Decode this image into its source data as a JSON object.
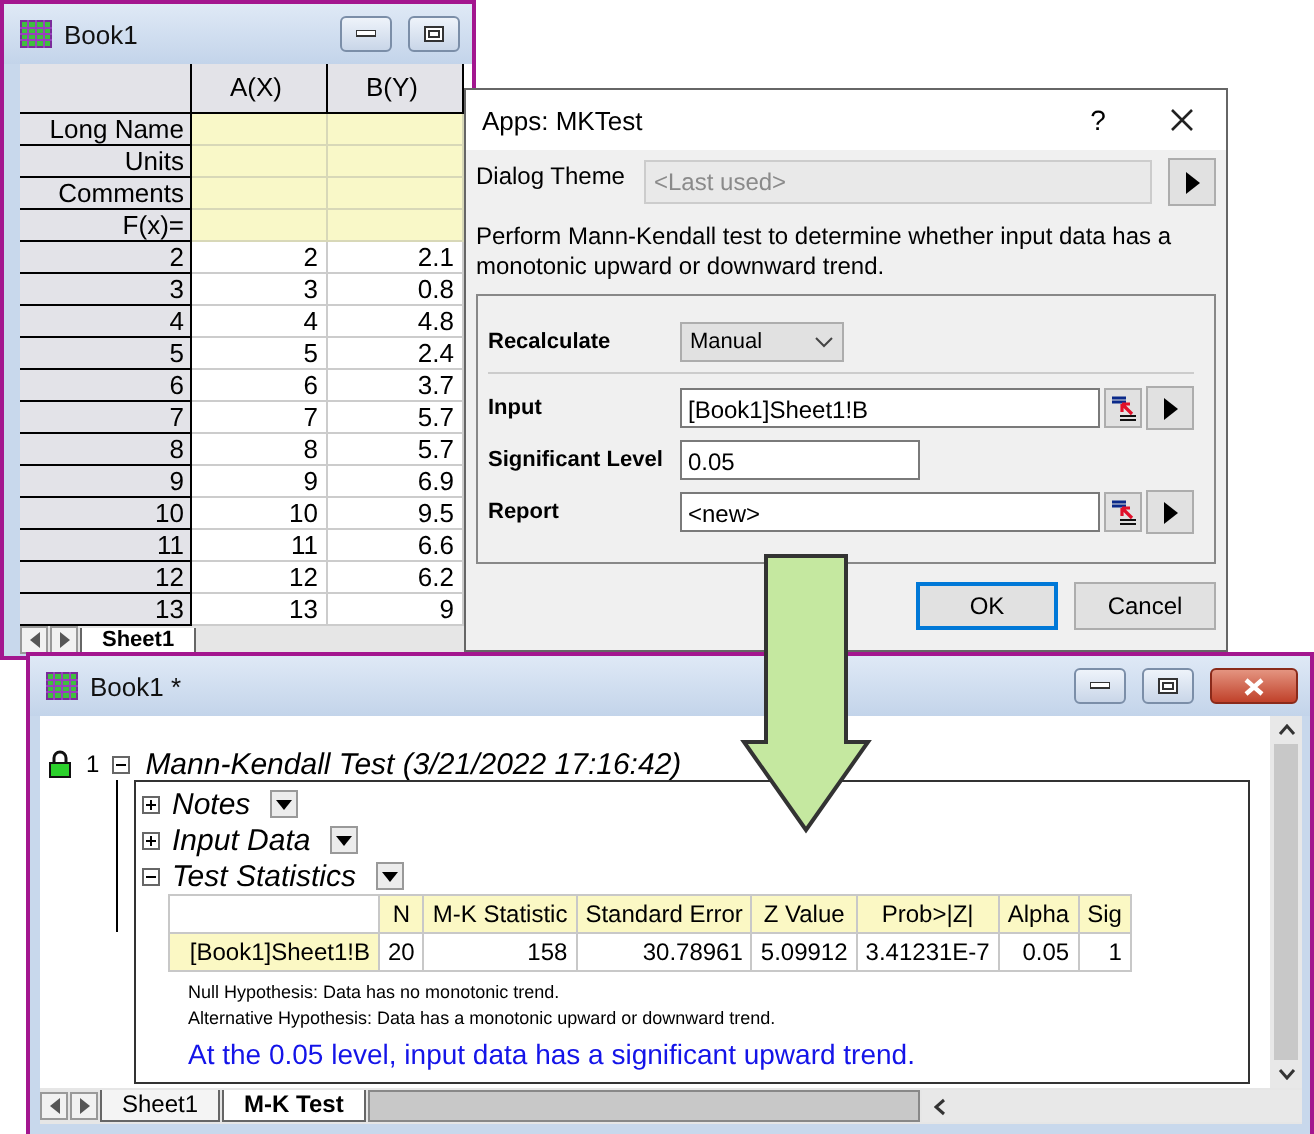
{
  "workbook": {
    "title": "Book1",
    "columns": [
      "A(X)",
      "B(Y)"
    ],
    "label_rows": [
      "Long Name",
      "Units",
      "Comments",
      "F(x)="
    ],
    "rows": [
      {
        "index": "2",
        "cells": [
          "2",
          "2.1"
        ]
      },
      {
        "index": "3",
        "cells": [
          "3",
          "0.8"
        ]
      },
      {
        "index": "4",
        "cells": [
          "4",
          "4.8"
        ]
      },
      {
        "index": "5",
        "cells": [
          "5",
          "2.4"
        ]
      },
      {
        "index": "6",
        "cells": [
          "6",
          "3.7"
        ]
      },
      {
        "index": "7",
        "cells": [
          "7",
          "5.7"
        ]
      },
      {
        "index": "8",
        "cells": [
          "8",
          "5.7"
        ]
      },
      {
        "index": "9",
        "cells": [
          "9",
          "6.9"
        ]
      },
      {
        "index": "10",
        "cells": [
          "10",
          "9.5"
        ]
      },
      {
        "index": "11",
        "cells": [
          "11",
          "6.6"
        ]
      },
      {
        "index": "12",
        "cells": [
          "12",
          "6.2"
        ]
      },
      {
        "index": "13",
        "cells": [
          "13",
          "9"
        ]
      }
    ],
    "sheet_tab": "Sheet1"
  },
  "dialog": {
    "title": "Apps: MKTest",
    "help": "?",
    "theme": {
      "label": "Dialog Theme",
      "value": "<Last used>",
      "disabled": true
    },
    "description": "Perform Mann-Kendall test to determine whether input data has a monotonic upward or downward trend.",
    "fields": [
      {
        "kind": "dropdown",
        "label": "Recalculate",
        "value": "Manual"
      },
      {
        "kind": "range",
        "label": "Input",
        "value": "[Book1]Sheet1!B"
      },
      {
        "kind": "text",
        "label": "Significant Level",
        "value": "0.05"
      },
      {
        "kind": "range",
        "label": "Report",
        "value": "<new>"
      }
    ],
    "buttons": [
      {
        "label": "OK",
        "default": true
      },
      {
        "label": "Cancel",
        "default": false
      }
    ]
  },
  "report_window": {
    "title": "Book1 *",
    "report": {
      "index": "1",
      "title": "Mann-Kendall Test (3/21/2022 17:16:42)",
      "expanded": true,
      "sections": [
        {
          "title": "Notes",
          "expanded": false
        },
        {
          "title": "Input Data",
          "expanded": false
        },
        {
          "title": "Test Statistics",
          "expanded": true,
          "table": {
            "columns": [
              "N",
              "M-K Statistic",
              "Standard Error",
              "Z Value",
              "Prob>|Z|",
              "Alpha",
              "Sig"
            ],
            "rows": [
              {
                "label": "[Book1]Sheet1!B",
                "cells": [
                  "20",
                  "158",
                  "30.78961",
                  "5.09912",
                  "3.41231E-7",
                  "0.05",
                  "1"
                ]
              }
            ]
          },
          "notes": [
            "Null Hypothesis: Data has no monotonic trend.",
            "Alternative Hypothesis: Data has a monotonic upward or downward trend."
          ],
          "conclusion": "At the 0.05 level, input data has a significant upward trend."
        }
      ]
    },
    "sheet_tabs": [
      {
        "label": "Sheet1",
        "selected": false
      },
      {
        "label": "M-K Test",
        "selected": true
      }
    ]
  }
}
